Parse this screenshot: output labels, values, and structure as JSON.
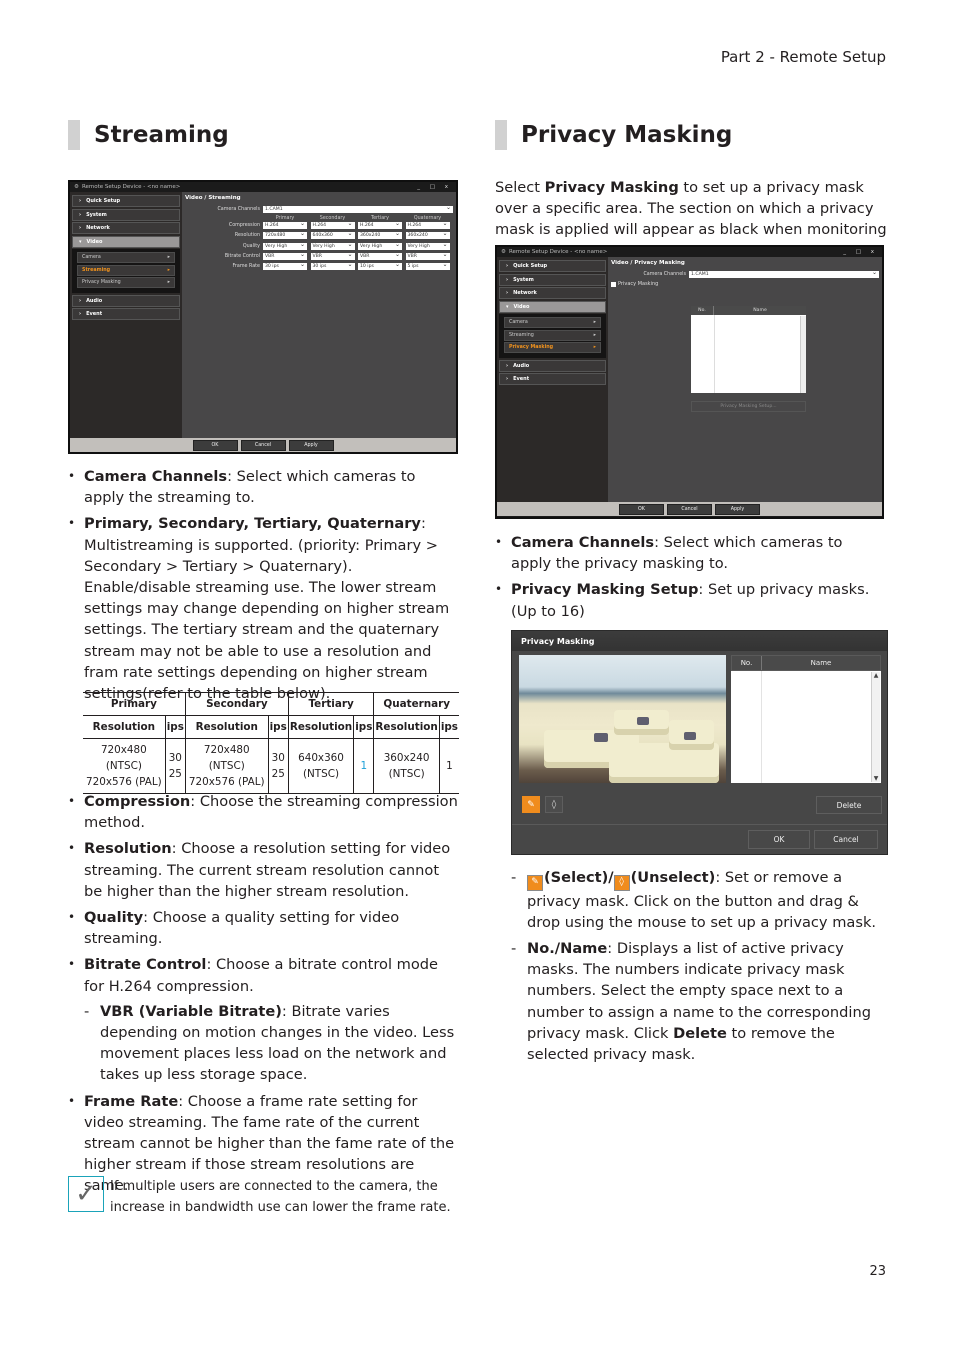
{
  "header": {
    "section": "Part 2 - Remote Setup"
  },
  "page_number": "23",
  "streaming": {
    "title": "Streaming",
    "window": {
      "title": "Remote Setup Device - <no name>",
      "controls": "_ □ x",
      "nav": [
        {
          "label": "Quick Setup"
        },
        {
          "label": "System"
        },
        {
          "label": "Network"
        },
        {
          "label": "Video"
        },
        {
          "label": "Audio"
        },
        {
          "label": "Event"
        }
      ],
      "subnav": [
        {
          "label": "Camera"
        },
        {
          "label": "Streaming"
        },
        {
          "label": "Privacy Masking"
        }
      ],
      "main_title": "Video / Streaming",
      "camera_channels_label": "Camera Channels",
      "camera_channels_value": "1.CAM1",
      "columns": [
        "Primary",
        "Secondary",
        "Tertiary",
        "Quaternary"
      ],
      "rows": [
        {
          "label": "Compression",
          "values": [
            "H.264",
            "H.264",
            "H.264",
            "H.264"
          ]
        },
        {
          "label": "Resolution",
          "values": [
            "720x480",
            "640x360",
            "360x240",
            "360x240"
          ]
        },
        {
          "label": "Quality",
          "values": [
            "Very High",
            "Very High",
            "Very High",
            "Very High"
          ]
        },
        {
          "label": "Bitrate Control",
          "values": [
            "VBR",
            "VBR",
            "VBR",
            "VBR"
          ]
        },
        {
          "label": "Frame Rate",
          "values": [
            "30 ips",
            "30 ips",
            "10 ips",
            "5 ips"
          ]
        }
      ],
      "buttons": {
        "ok": "OK",
        "cancel": "Cancel",
        "apply": "Apply"
      }
    },
    "bullets_top": [
      {
        "bold": "Camera Channels",
        "text": ": Select which cameras to apply the streaming to."
      },
      {
        "bold": "Primary, Secondary, Tertiary, Quaternary",
        "text": ": Multistreaming is supported. (priority: Primary > Secondary > Tertiary > Quaternary). Enable/disable streaming use. The lower stream settings may change depending on higher stream settings. The tertiary stream and the quaternary stream may not be able to use a resolution and fram rate settings depending on higher stream settings(refer to the table below)."
      }
    ],
    "table": {
      "groups": [
        "Primary",
        "Secondary",
        "Tertiary",
        "Quaternary"
      ],
      "subheaders": [
        "Resolution",
        "ips",
        "Resolution",
        "ips",
        "Resolution",
        "ips",
        "Resolution",
        "ips"
      ],
      "row": [
        {
          "l1": "720x480 (NTSC)",
          "l2": "720x576 (PAL)"
        },
        {
          "l1": "30",
          "l2": "25"
        },
        {
          "l1": "720x480 (NTSC)",
          "l2": "720x576 (PAL)"
        },
        {
          "l1": "30",
          "l2": "25"
        },
        {
          "l1": "640x360",
          "l2": "(NTSC)"
        },
        {
          "l1": "1",
          "l2": ""
        },
        {
          "l1": "360x240",
          "l2": "(NTSC)"
        },
        {
          "l1": "1",
          "l2": ""
        }
      ]
    },
    "bullets_bottom": [
      {
        "bold": "Compression",
        "text": ": Choose the streaming compression method."
      },
      {
        "bold": "Resolution",
        "text": ": Choose a resolution setting for video streaming. The current stream resolution cannot be higher than the higher stream resolution."
      },
      {
        "bold": "Quality",
        "text": ": Choose a quality setting for video streaming."
      },
      {
        "bold": "Bitrate Control",
        "text": ": Choose a bitrate control mode for H.264 compression."
      },
      {
        "bold": "Frame Rate",
        "text": ": Choose a frame rate setting for video streaming. The fame rate of the current stream cannot be higher than the fame rate of the higher stream if those stream resolutions are same."
      }
    ],
    "vbr": {
      "bold": "VBR (Variable Bitrate)",
      "text": ": Bitrate varies depending on motion changes in the video. Less movement places less load on the network and takes up less storage space."
    },
    "note": "If multiple users are connected to the camera, the increase in bandwidth use can lower the frame rate."
  },
  "privacy": {
    "title": "Privacy Masking",
    "intro_pre": "Select ",
    "intro_bold": "Privacy Masking",
    "intro_post": " to set up a privacy mask over a specific area. The section on which a privacy mask is applied will appear as black when monitoring video.",
    "window": {
      "title": "Remote Setup Device - <no name>",
      "controls": "_ □ x",
      "main_title": "Video / Privacy Masking",
      "camera_channels_label": "Camera Channels",
      "camera_channels_value": "1.CAM1",
      "checkbox_label": "Privacy Masking",
      "col_no": "No.",
      "col_name": "Name",
      "setup_button": "Privacy Masking Setup...",
      "buttons": {
        "ok": "OK",
        "cancel": "Cancel",
        "apply": "Apply"
      }
    },
    "bullets": [
      {
        "bold": "Camera Channels",
        "text": ": Select which cameras to apply the privacy masking to."
      },
      {
        "bold": "Privacy Masking Setup",
        "text": ": Set up privacy masks. (Up to 16)"
      }
    ],
    "dialog": {
      "title": "Privacy Masking",
      "col_no": "No.",
      "col_name": "Name",
      "delete": "Delete",
      "ok": "OK",
      "cancel": "Cancel"
    },
    "sub_bullets": {
      "select_bold": "(Select)/",
      "unselect_bold": "(Unselect)",
      "select_text": ": Set or remove a privacy mask. Click on the button and drag & drop using the mouse to set up a privacy mask.",
      "noname_bold": "No./Name",
      "noname_text": ": Displays a list of active privacy masks. The numbers indicate privacy mask numbers. Select the empty space next to a number to assign a name to the corresponding privacy mask. Click ",
      "delete_bold": "Delete",
      "noname_text2": " to remove the selected privacy mask."
    }
  }
}
